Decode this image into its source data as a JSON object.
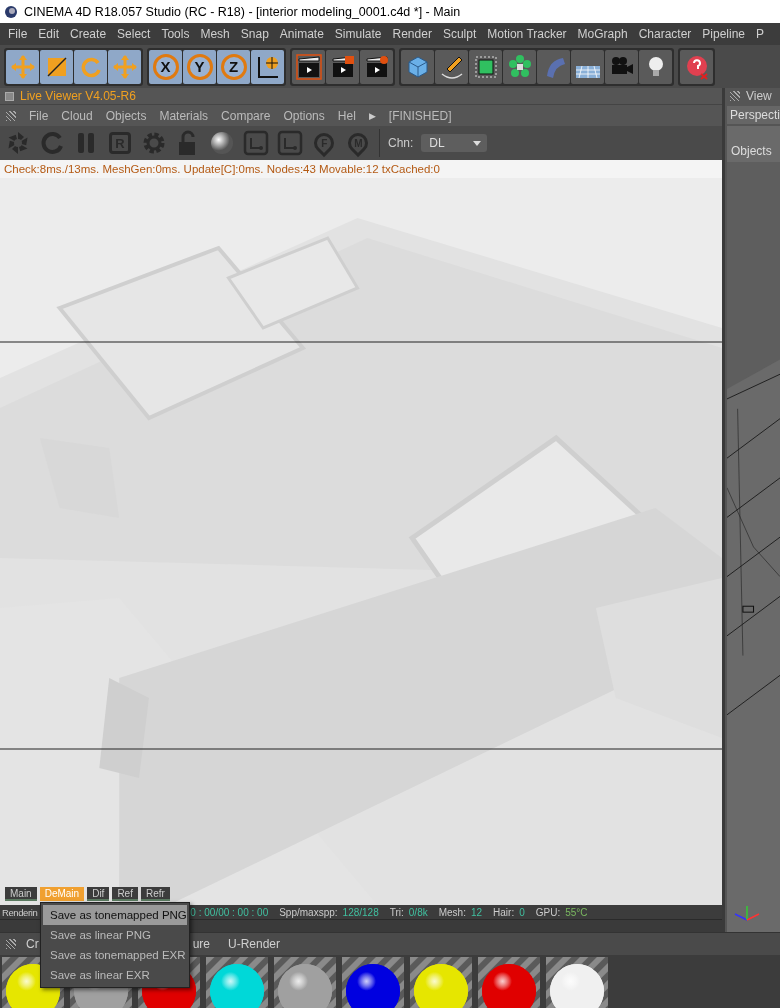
{
  "window": {
    "title": "CINEMA 4D R18.057 Studio (RC - R18) - [interior modeling_0001.c4d *] - Main"
  },
  "menu": [
    "File",
    "Edit",
    "Create",
    "Select",
    "Tools",
    "Mesh",
    "Snap",
    "Animate",
    "Simulate",
    "Render",
    "Sculpt",
    "Motion Tracker",
    "MoGraph",
    "Character",
    "Pipeline",
    "P"
  ],
  "toolbar": {
    "axis_buttons": [
      {
        "label": "X",
        "active": true
      },
      {
        "label": "Y",
        "active": true
      },
      {
        "label": "Z",
        "active": true
      }
    ]
  },
  "live_viewer": {
    "title": "Live Viewer V4.05-R6",
    "menu": [
      "File",
      "Cloud",
      "Objects",
      "Materials",
      "Compare",
      "Options",
      "Hel"
    ],
    "menu_arrow": "▶",
    "status": "[FINISHED]",
    "tools": [
      {
        "kind": "burst"
      },
      {
        "kind": "reload"
      },
      {
        "kind": "pause"
      },
      {
        "kind": "letter",
        "label": "R"
      },
      {
        "kind": "gear"
      },
      {
        "kind": "lock"
      },
      {
        "kind": "sphere"
      },
      {
        "kind": "region"
      },
      {
        "kind": "region"
      },
      {
        "kind": "pin",
        "label": "F"
      },
      {
        "kind": "pin",
        "label": "M"
      }
    ],
    "channel": {
      "label": "Chn:",
      "value": "DL"
    },
    "info": "Check:8ms./13ms. MeshGen:0ms. Update[C]:0ms. Nodes:43 Movable:12 txCached:0",
    "tabs": [
      {
        "label": "Main",
        "selected": false
      },
      {
        "label": "DeMain",
        "selected": true
      },
      {
        "label": "Dif",
        "selected": false
      },
      {
        "label": "Ref",
        "selected": false
      },
      {
        "label": "Refr",
        "selected": false
      }
    ],
    "status_bar": [
      {
        "label": "Renderin"
      },
      {
        "value": "0 : 00/00 : 00 : 00"
      },
      {
        "label": "Spp/maxspp:",
        "value": "128/128"
      },
      {
        "label": "Tri:",
        "value": "0/8k"
      },
      {
        "label": "Mesh:",
        "value": "12"
      },
      {
        "label": "Hair:",
        "value": "0"
      },
      {
        "label": "GPU:"
      },
      {
        "value": "55°C",
        "kind": "temp"
      }
    ]
  },
  "context_menu": [
    {
      "label": "Save as tonemapped PNG",
      "selected": true
    },
    {
      "label": "Save as linear PNG",
      "selected": false
    },
    {
      "label": "Save as tonemapped EXR",
      "selected": false
    },
    {
      "label": "Save as linear EXR",
      "selected": false
    }
  ],
  "viewport": {
    "header": "View",
    "tab": "Perspecti",
    "menu": "Objects"
  },
  "material_manager": {
    "menu": [
      "Cr",
      "ure",
      "U-Render"
    ],
    "materials": [
      {
        "color": "#e6e600"
      },
      {
        "color": "#a0a0a0"
      },
      {
        "color": "#e00000"
      },
      {
        "color": "#00d8d8"
      },
      {
        "color": "#a0a0a0"
      },
      {
        "color": "#0000e0"
      },
      {
        "color": "#e6e600"
      },
      {
        "color": "#e00000"
      },
      {
        "color": "#f0f0f0"
      }
    ]
  }
}
